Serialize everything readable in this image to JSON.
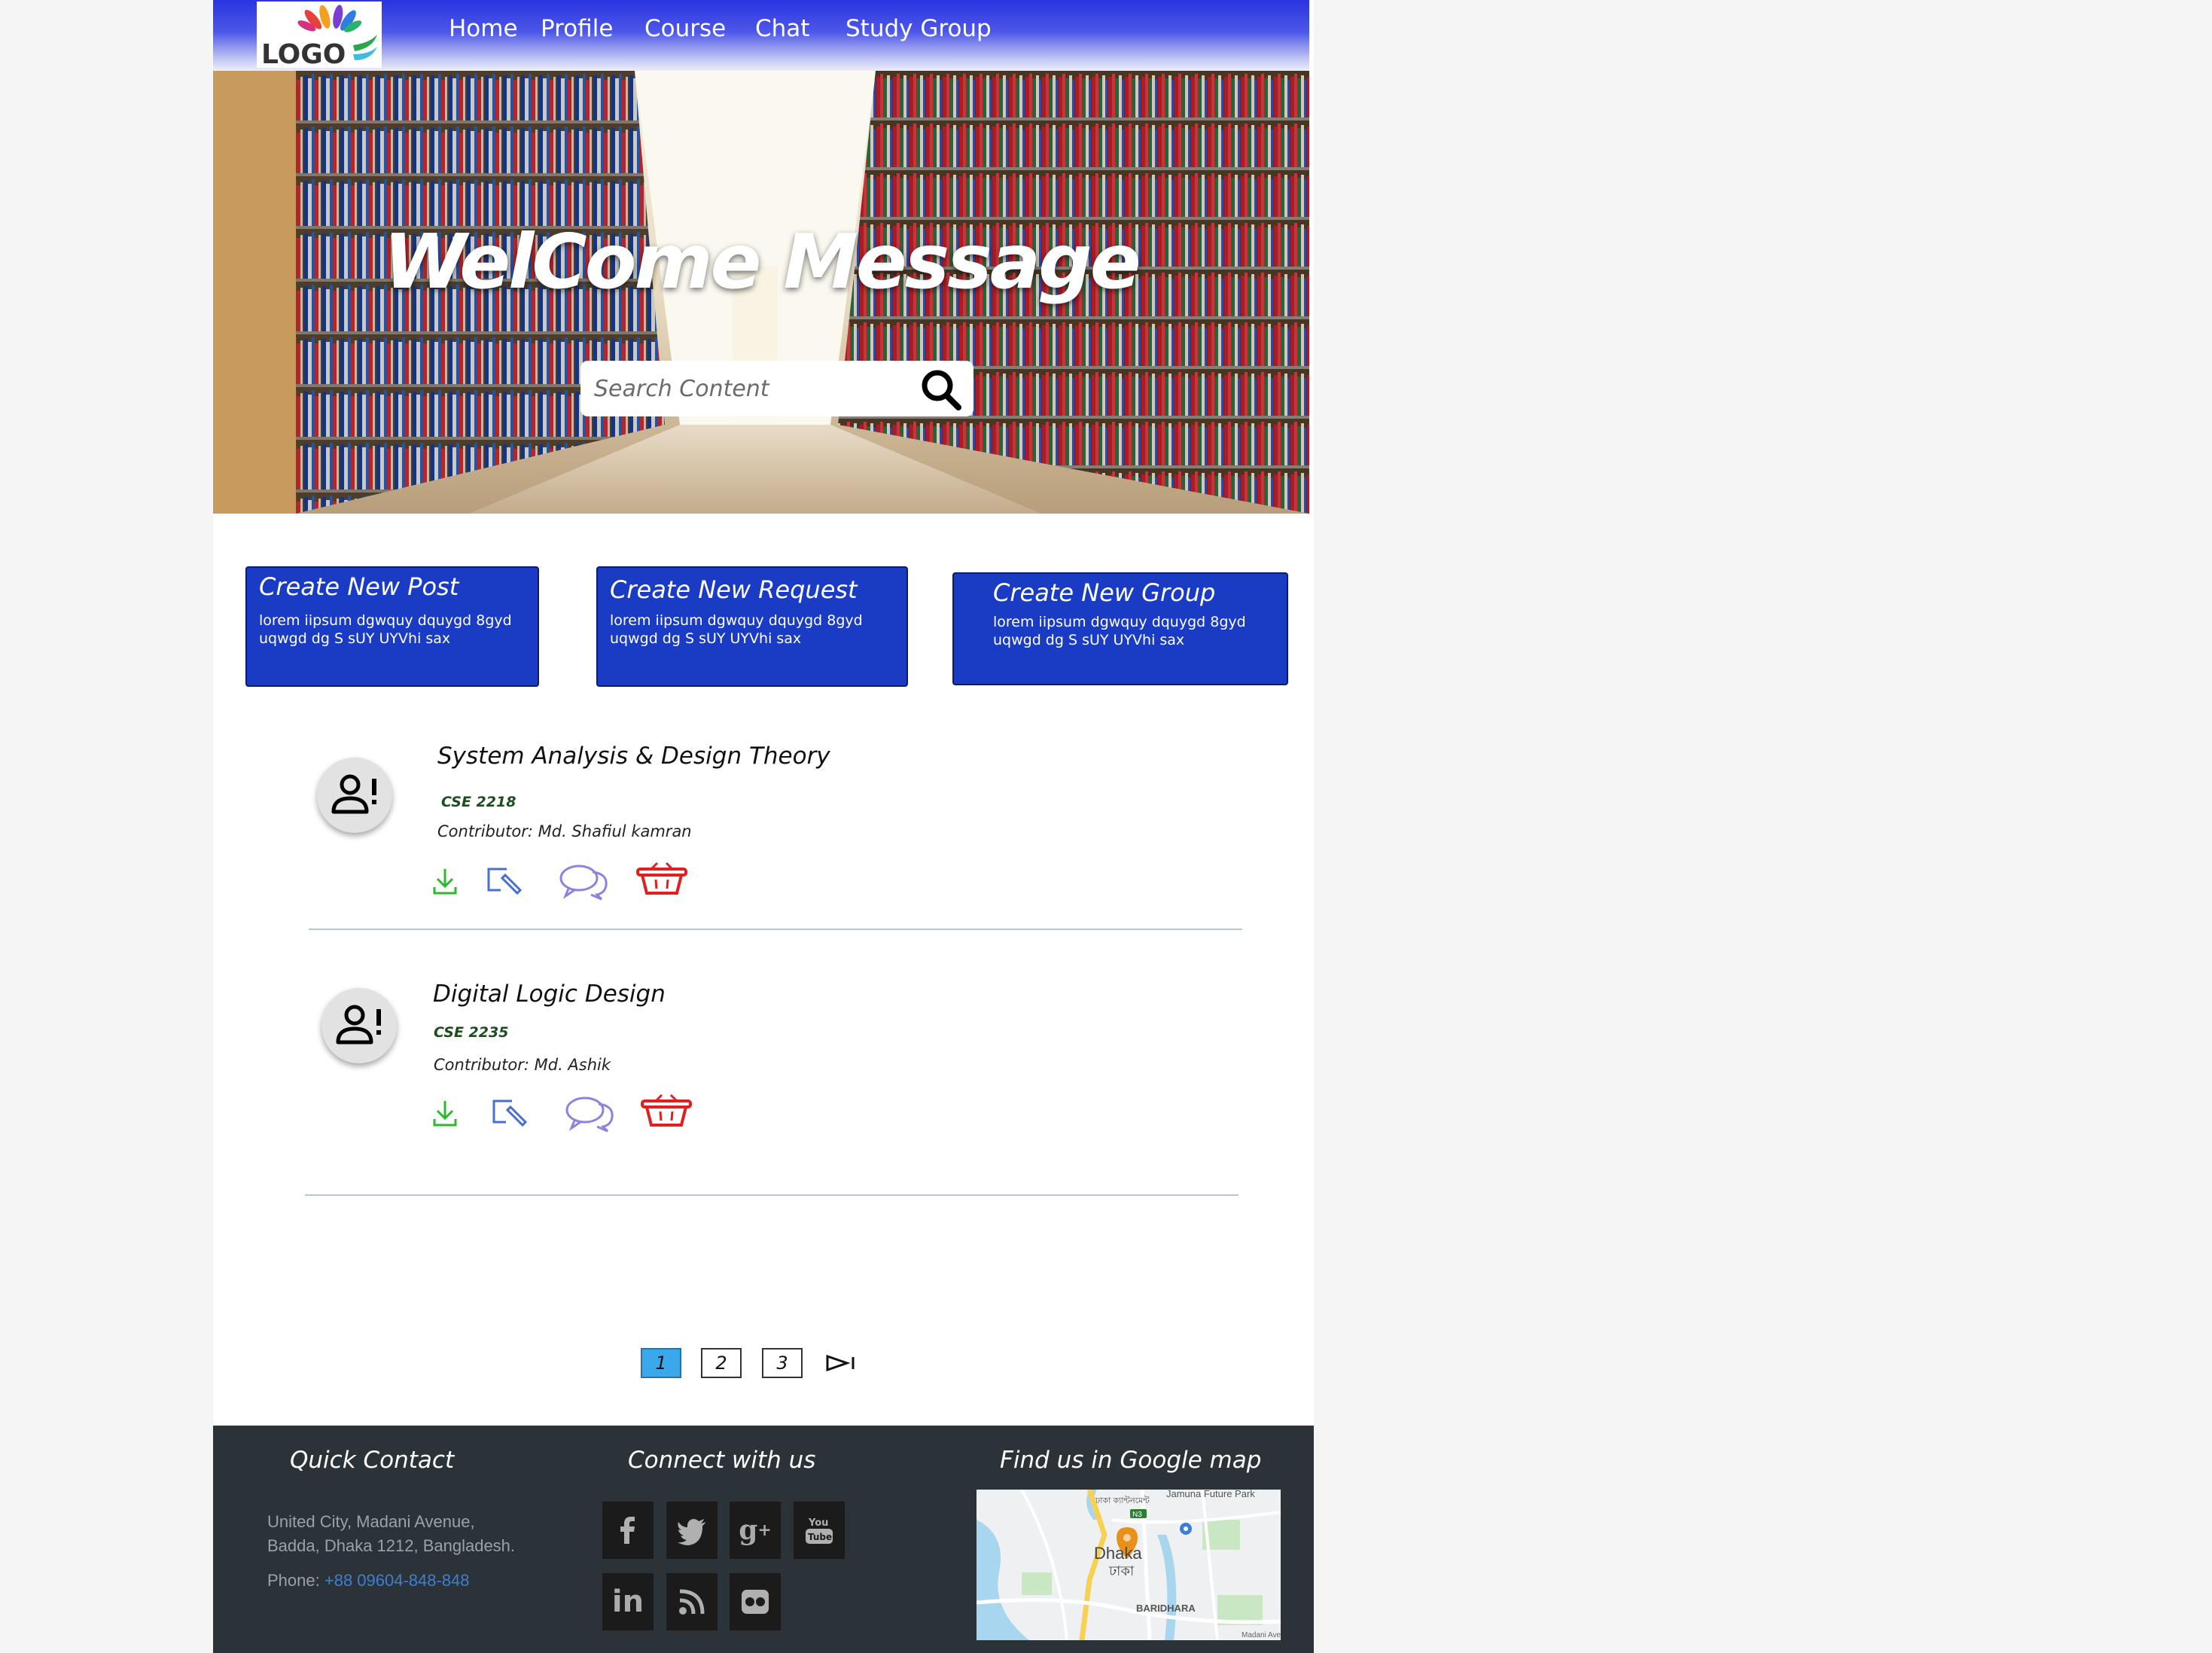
{
  "nav": {
    "logo_text": "LOGO",
    "links": [
      "Home",
      "Profile",
      "Course",
      "Chat",
      "Study Group"
    ]
  },
  "hero": {
    "welcome": "WelCome Message",
    "search_placeholder": "Search Content"
  },
  "actions": [
    {
      "title": "Create New Post",
      "desc": "lorem iipsum dgwquy dquygd 8gyd uqwgd dg S sUY UYVhi sax"
    },
    {
      "title": "Create New Request",
      "desc": "lorem iipsum dgwquy dquygd 8gyd uqwgd dg S sUY UYVhi sax"
    },
    {
      "title": "Create New Group",
      "desc": "lorem iipsum dgwquy dquygd 8gyd uqwgd dg S sUY UYVhi sax"
    }
  ],
  "items": [
    {
      "title": "System Analysis & Design  Theory",
      "code": "CSE 2218",
      "contributor": "Contributor: Md. Shafiul kamran"
    },
    {
      "title": "Digital Logic Design",
      "code": "CSE 2235",
      "contributor": "Contributor: Md. Ashik"
    }
  ],
  "icons": {
    "download": "download-icon",
    "edit": "edit-icon",
    "comment": "comment-icon",
    "delete": "basket-icon",
    "avatar": "person-alert-icon",
    "search": "search-icon"
  },
  "pagination": {
    "pages": [
      "1",
      "2",
      "3"
    ],
    "current": "1"
  },
  "footer": {
    "quick_contact": {
      "heading": "Quick Contact",
      "address_line1": "United City, Madani Avenue,",
      "address_line2": "Badda, Dhaka 1212, Bangladesh.",
      "phone_label": "Phone:",
      "phone": "+88 09604-848-848"
    },
    "connect": {
      "heading": "Connect with us",
      "networks": [
        "facebook",
        "twitter",
        "google-plus",
        "youtube",
        "linkedin",
        "rss",
        "flickr"
      ]
    },
    "map": {
      "heading": "Find us in Google map",
      "labels": {
        "dhaka": "Dhaka",
        "dhaka_bn": "ঢাকা",
        "park": "Jamuna Future Park",
        "area": "BARIDHARA",
        "avenue": "Madani Ave",
        "cantonment": "ঢাকা ক্যান্টনমেন্ট",
        "road": "N3"
      }
    }
  },
  "colors": {
    "nav_top": "#2a34e0",
    "card_bg": "#1a3bc4",
    "download": "#2eb82e",
    "edit": "#4a6fd4",
    "comment": "#8a84e0",
    "delete": "#e02020",
    "page_active": "#3aa9ec",
    "footer_bg": "#2b3339",
    "phone_link": "#3d7fd1"
  }
}
